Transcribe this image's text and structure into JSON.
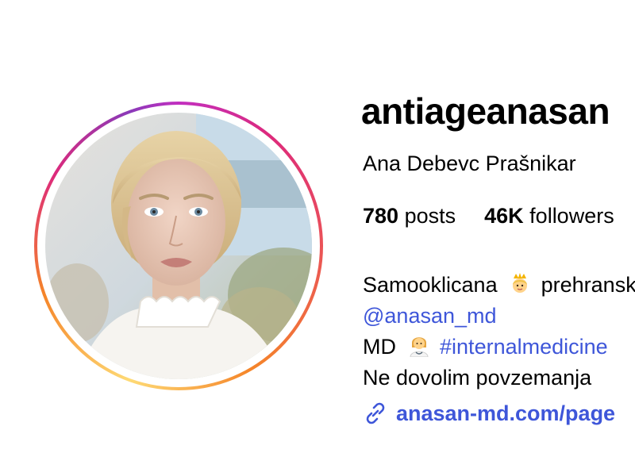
{
  "profile": {
    "username": "antiageanasan",
    "full_name": "Ana Debevc Prašnikar",
    "stats": {
      "posts_count": "780",
      "posts_label": "posts",
      "followers_count": "46K",
      "followers_label": "followers"
    },
    "bio": {
      "line1_text": "Samooklicana",
      "line1_emoji": "princess-emoji",
      "line1_after": "prehranska",
      "line2_mention": "@anasan_md",
      "line3_prefix": "MD",
      "line3_emoji": "doctor-emoji",
      "line3_hashtag": "#internalmedicine",
      "line4_text": "Ne dovolim povzemanja"
    },
    "website": "anasan-md.com/page",
    "colors": {
      "link": "#3e56d9",
      "ring_start": "#c22fc0",
      "ring_end": "#feda75"
    }
  }
}
